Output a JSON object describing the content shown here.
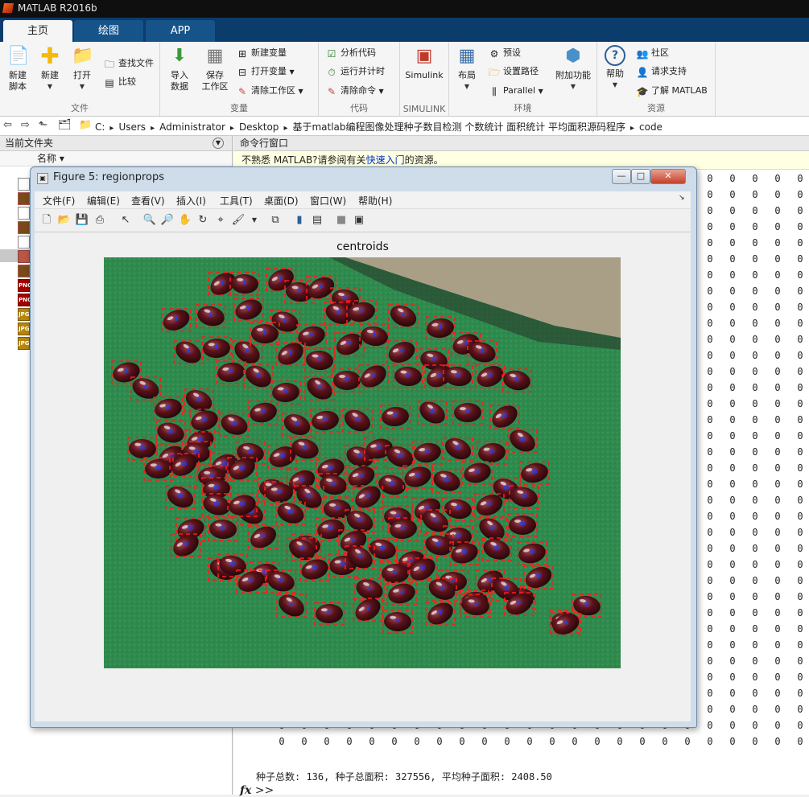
{
  "app": {
    "title": "MATLAB R2016b"
  },
  "tabs": [
    {
      "label": "主页",
      "active": true
    },
    {
      "label": "绘图"
    },
    {
      "label": "APP"
    }
  ],
  "ribbon": {
    "file": {
      "title": "文件",
      "new_script": "新建\n脚本",
      "new": "新建",
      "open": "打开",
      "find_files": "查找文件",
      "compare": "比较"
    },
    "variable": {
      "title": "变量",
      "import": "导入\n数据",
      "save_ws": "保存\n工作区",
      "new_var": "新建变量",
      "open_var": "打开变量",
      "clear_ws": "清除工作区"
    },
    "code": {
      "title": "代码",
      "analyze": "分析代码",
      "run_time": "运行并计时",
      "clear_cmd": "清除命令"
    },
    "simulink": {
      "title": "SIMULINK",
      "simulink": "Simulink"
    },
    "env": {
      "title": "环境",
      "layout": "布局",
      "prefs": "预设",
      "set_path": "设置路径",
      "parallel": "Parallel",
      "addons": "附加功能"
    },
    "resources": {
      "title": "资源",
      "help": "帮助",
      "community": "社区",
      "support": "请求支持",
      "learn": "了解 MATLAB"
    }
  },
  "address": {
    "crumbs": [
      "C:",
      "Users",
      "Administrator",
      "Desktop",
      "基于matlab编程图像处理种子数目检测 个数统计 面积统计 平均面积源码程序",
      "code"
    ]
  },
  "left_panel": {
    "title": "当前文件夹",
    "col_name": "名称 ▾",
    "file_badges": [
      "PNG",
      "PNG",
      "JPG",
      "JPG",
      "JPG"
    ]
  },
  "command_window": {
    "title": "命令行窗口",
    "tip_pre": "不熟悉 MATLAB?请参阅有关",
    "tip_link": "快速入门",
    "tip_post": "的资源。",
    "zero": "0",
    "summary": "种子总数: 136, 种子总面积: 327556, 平均种子面积: 2408.50",
    "prompt": ">>",
    "fx": "fx"
  },
  "figure": {
    "title": "Figure 5: regionprops",
    "menu": [
      "文件(F)",
      "编辑(E)",
      "查看(V)",
      "插入(I)",
      "工具(T)",
      "桌面(D)",
      "窗口(W)",
      "帮助(H)"
    ],
    "axes_title": "centroids"
  },
  "colors": {
    "ribbon_tab_bg": "#0b3c6c",
    "figure_bg": "#f0f0f0",
    "grass": "#2f8a4e",
    "seed": "#4a0d12",
    "marker": "#1a3dff",
    "bbox": "#ff1a1a"
  }
}
